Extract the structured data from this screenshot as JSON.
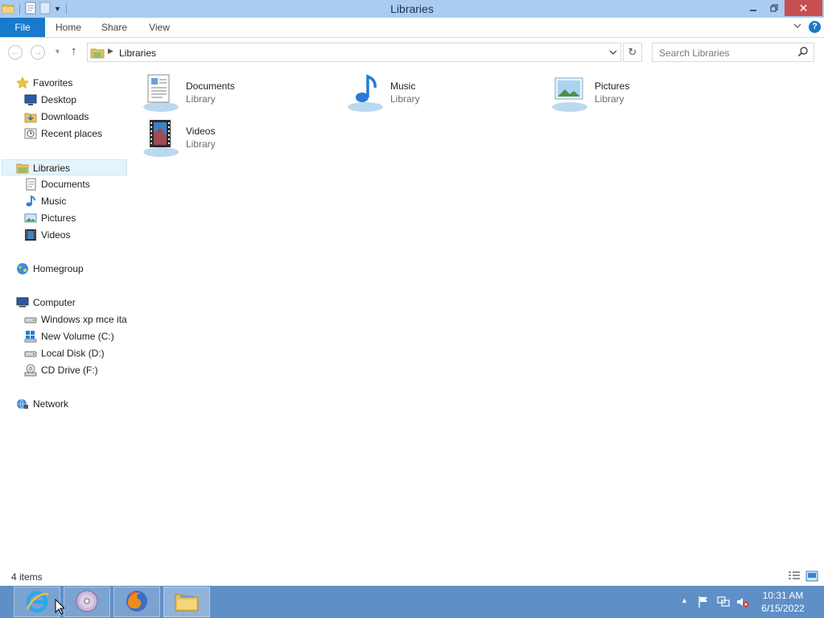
{
  "window": {
    "title": "Libraries"
  },
  "ribbon": {
    "tabs": [
      {
        "label": "File"
      },
      {
        "label": "Home"
      },
      {
        "label": "Share"
      },
      {
        "label": "View"
      }
    ]
  },
  "address": {
    "crumb": "Libraries",
    "search_placeholder": "Search Libraries"
  },
  "nav": {
    "favorites": {
      "label": "Favorites",
      "items": [
        {
          "label": "Desktop"
        },
        {
          "label": "Downloads"
        },
        {
          "label": "Recent places"
        }
      ]
    },
    "libraries": {
      "label": "Libraries",
      "items": [
        {
          "label": "Documents"
        },
        {
          "label": "Music"
        },
        {
          "label": "Pictures"
        },
        {
          "label": "Videos"
        }
      ]
    },
    "homegroup": {
      "label": "Homegroup"
    },
    "computer": {
      "label": "Computer",
      "items": [
        {
          "label": "Windows xp mce ita"
        },
        {
          "label": "New Volume (C:)"
        },
        {
          "label": "Local Disk (D:)"
        },
        {
          "label": "CD Drive (F:)"
        }
      ]
    },
    "network": {
      "label": "Network"
    }
  },
  "content": {
    "items": [
      {
        "name": "Documents",
        "type": "Library"
      },
      {
        "name": "Music",
        "type": "Library"
      },
      {
        "name": "Pictures",
        "type": "Library"
      },
      {
        "name": "Videos",
        "type": "Library"
      }
    ]
  },
  "status": {
    "count": "4 items"
  },
  "taskbar": {
    "clock_time": "10:31 AM",
    "clock_date": "6/15/2022"
  },
  "colors": {
    "accent": "#1979ca",
    "titlebar": "#a9ccf0",
    "close": "#c74f50",
    "taskbar": "#5f8fc7",
    "selection": "#e5f3fb"
  }
}
